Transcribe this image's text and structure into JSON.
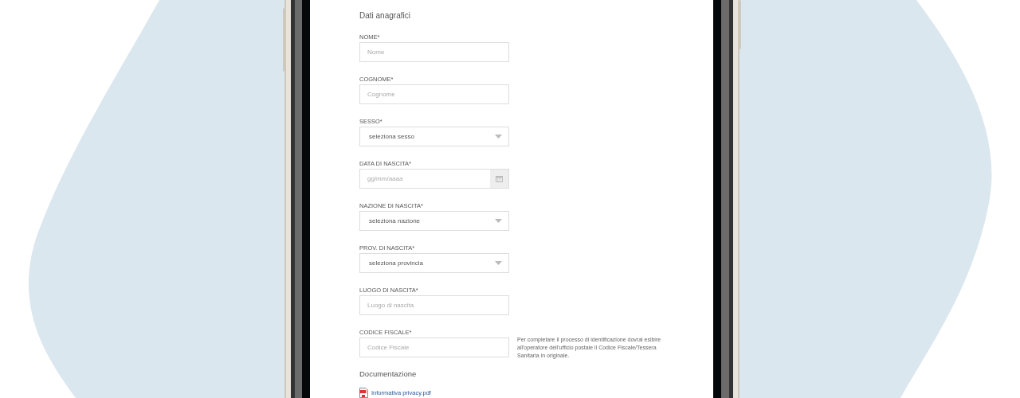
{
  "section_title": "Dati anagrafici",
  "fields": [
    {
      "kind": "text",
      "label": "NOME*",
      "placeholder": "Nome"
    },
    {
      "kind": "text",
      "label": "COGNOME*",
      "placeholder": "Cognome"
    },
    {
      "kind": "select",
      "label": "SESSO*",
      "value": "seleziona sesso"
    },
    {
      "kind": "date",
      "label": "DATA DI NASCITA*",
      "placeholder": "gg/mm/aaaa"
    },
    {
      "kind": "select",
      "label": "NAZIONE DI NASCITA*",
      "value": "seleziona nazione"
    },
    {
      "kind": "select",
      "label": "PROV. DI NASCITA*",
      "value": "seleziona provincia"
    },
    {
      "kind": "text",
      "label": "LUOGO DI NASCITA*",
      "placeholder": "Luogo di nascita"
    },
    {
      "kind": "text",
      "label": "CODICE FISCALE*",
      "placeholder": "Codice Fiscale",
      "help": "Per completare il processo di identificazione dovrai esibire all'operatore dell'ufficio postale il Codice Fiscale/Tessera Sanitaria in originale."
    }
  ],
  "documents": {
    "title": "Documentazione",
    "items": [
      {
        "name": "Informativa privacy.pdf"
      }
    ]
  }
}
